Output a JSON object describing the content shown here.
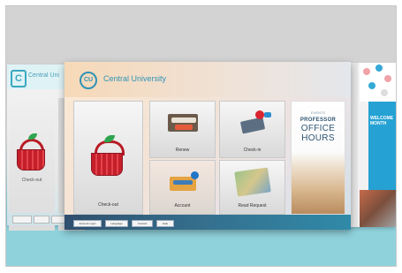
{
  "left_window": {
    "logo": "C",
    "title": "Central Uni",
    "tile_caption": "Check-out"
  },
  "main_window": {
    "logo": "CU",
    "title": "Central University",
    "tiles": [
      {
        "label": "Check-out"
      },
      {
        "label": "Renew"
      },
      {
        "label": "Check-in"
      },
      {
        "label": "Account"
      },
      {
        "label": "Read Request"
      }
    ],
    "poster": {
      "small_heading": "EVENTS",
      "lines": [
        "PROFESSOR",
        "OFFICE",
        "HOURS"
      ]
    },
    "footer_buttons": [
      "Account Login",
      "Language",
      "Contact",
      "Help"
    ]
  },
  "right_window": {
    "panel_text": "WELCOME MONTH"
  },
  "colors": {
    "accent": "#2f93b5",
    "footer": "#2f4f6d",
    "background_sea": "#8fd2dc",
    "basket_red": "#c41f2b"
  }
}
